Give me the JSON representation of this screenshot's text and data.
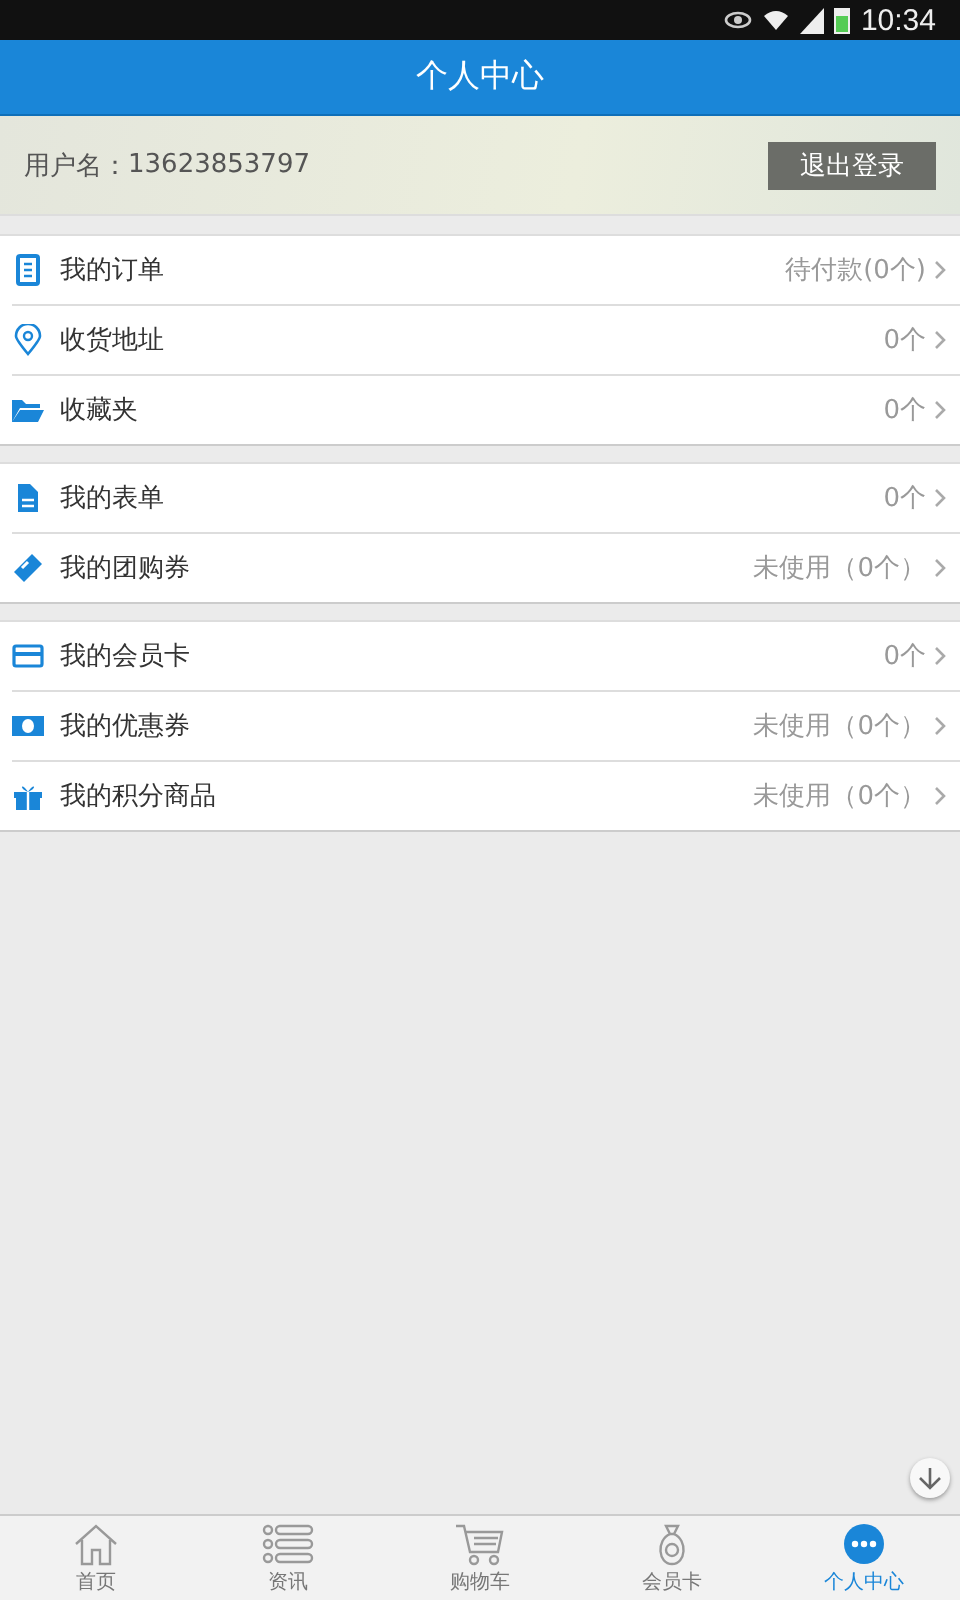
{
  "status_bar": {
    "time": "10:34"
  },
  "header": {
    "title": "个人中心"
  },
  "user": {
    "label": "用户名：",
    "value": "13623853797",
    "logout": "退出登录"
  },
  "groups": [
    {
      "items": [
        {
          "kind": "list",
          "label": "我的订单",
          "value": "待付款(0个)"
        },
        {
          "kind": "pin",
          "label": "收货地址",
          "value": "0个"
        },
        {
          "kind": "folder",
          "label": "收藏夹",
          "value": "0个"
        }
      ]
    },
    {
      "items": [
        {
          "kind": "doc",
          "label": "我的表单",
          "value": "0个"
        },
        {
          "kind": "ticket",
          "label": "我的团购券",
          "value": "未使用（0个）"
        }
      ]
    },
    {
      "items": [
        {
          "kind": "card",
          "label": "我的会员卡",
          "value": "0个"
        },
        {
          "kind": "cash",
          "label": "我的优惠券",
          "value": "未使用（0个）"
        },
        {
          "kind": "gift",
          "label": "我的积分商品",
          "value": "未使用（0个）"
        }
      ]
    }
  ],
  "tabs": [
    {
      "kind": "home",
      "label": "首页",
      "selected": false
    },
    {
      "kind": "list",
      "label": "资讯",
      "selected": false
    },
    {
      "kind": "cart",
      "label": "购物车",
      "selected": false
    },
    {
      "kind": "bag",
      "label": "会员卡",
      "selected": false
    },
    {
      "kind": "more",
      "label": "个人中心",
      "selected": true
    }
  ]
}
